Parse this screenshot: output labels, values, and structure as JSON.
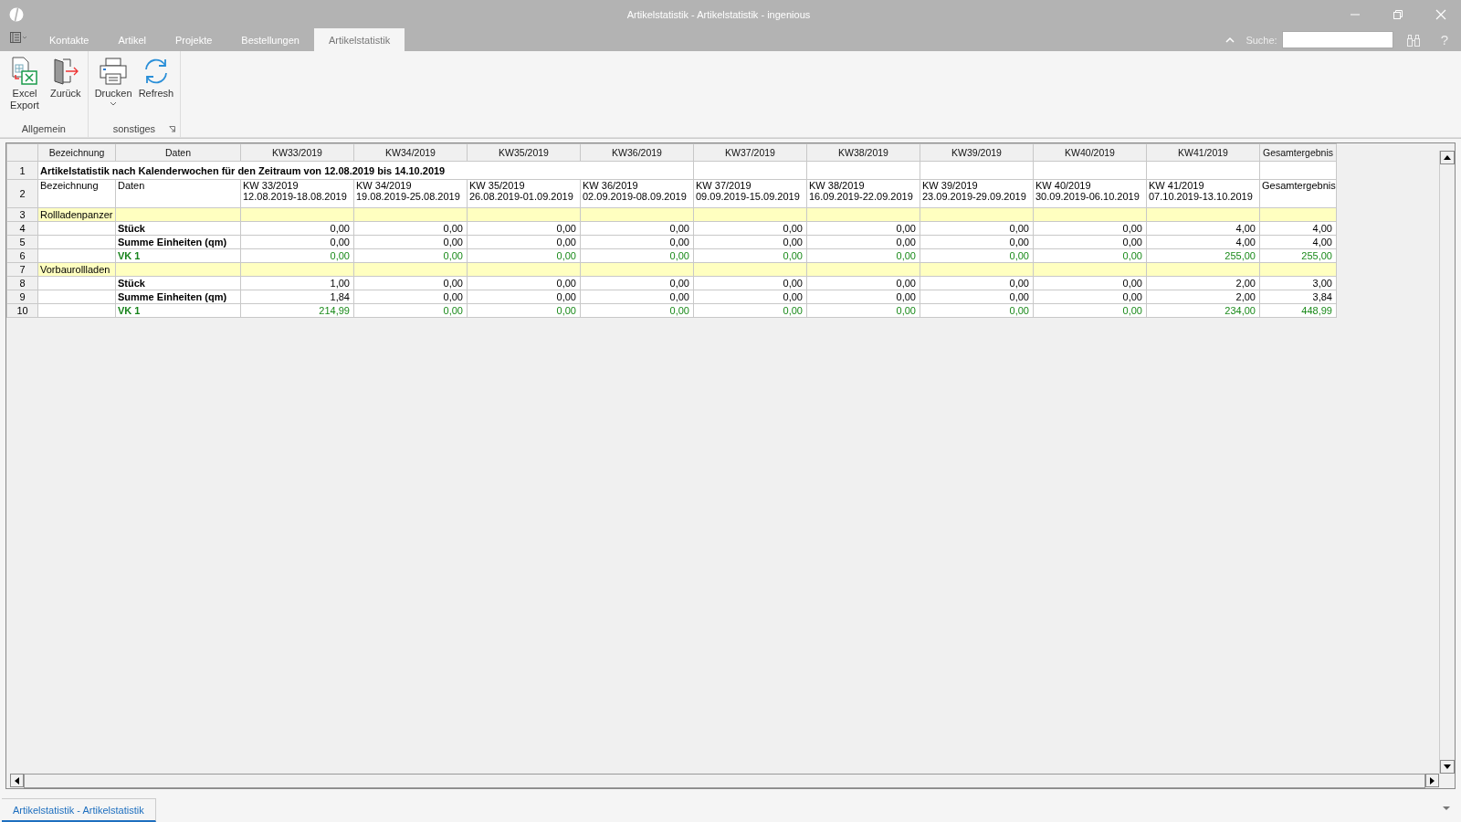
{
  "window": {
    "title": "Artikelstatistik - Artikelstatistik - ingenious"
  },
  "menu_tabs": [
    {
      "label": "Kontakte",
      "selected": false
    },
    {
      "label": "Artikel",
      "selected": false
    },
    {
      "label": "Projekte",
      "selected": false
    },
    {
      "label": "Bestellungen",
      "selected": false
    },
    {
      "label": "Artikelstatistik",
      "selected": true
    }
  ],
  "search": {
    "label": "Suche:"
  },
  "help_button": "?",
  "ribbon": {
    "groups": [
      {
        "label": "Allgemein",
        "launcher": false,
        "buttons": [
          {
            "label": "Excel Export",
            "kind": "excel",
            "dropdown": false
          },
          {
            "label": "Zurück",
            "kind": "back",
            "dropdown": false
          }
        ]
      },
      {
        "label": "sonstiges",
        "launcher": true,
        "buttons": [
          {
            "label": "Drucken",
            "kind": "print",
            "dropdown": true
          },
          {
            "label": "Refresh",
            "kind": "refresh",
            "dropdown": false
          }
        ]
      }
    ]
  },
  "grid": {
    "columns": [
      "Bezeichnung",
      "Daten",
      "KW33/2019",
      "KW34/2019",
      "KW35/2019",
      "KW36/2019",
      "KW37/2019",
      "KW38/2019",
      "KW39/2019",
      "KW40/2019",
      "KW41/2019",
      "Gesamtergebnis"
    ],
    "rows": [
      {
        "number": "1",
        "kind": "title",
        "text": "Artikelstatistik nach Kalenderwochen für den Zeitraum von  12.08.2019 bis 14.10.2019"
      },
      {
        "number": "2",
        "kind": "subheader",
        "cells": [
          [
            "Bezeichnung"
          ],
          [
            "Daten"
          ],
          [
            "KW 33/2019",
            "12.08.2019-18.08.2019"
          ],
          [
            "KW 34/2019",
            "19.08.2019-25.08.2019"
          ],
          [
            "KW 35/2019",
            "26.08.2019-01.09.2019"
          ],
          [
            "KW 36/2019",
            "02.09.2019-08.09.2019"
          ],
          [
            "KW 37/2019",
            "09.09.2019-15.09.2019"
          ],
          [
            "KW 38/2019",
            "16.09.2019-22.09.2019"
          ],
          [
            "KW 39/2019",
            "23.09.2019-29.09.2019"
          ],
          [
            "KW 40/2019",
            "30.09.2019-06.10.2019"
          ],
          [
            "KW 41/2019",
            "07.10.2019-13.10.2019"
          ],
          [
            "Gesamtergebnis"
          ]
        ]
      },
      {
        "number": "3",
        "kind": "group",
        "name": "Rollladenpanzer"
      },
      {
        "number": "4",
        "kind": "value",
        "label": "Stück",
        "values": [
          "0,00",
          "0,00",
          "0,00",
          "0,00",
          "0,00",
          "0,00",
          "0,00",
          "0,00",
          "4,00",
          "4,00"
        ]
      },
      {
        "number": "5",
        "kind": "value",
        "label": "Summe Einheiten (qm)",
        "values": [
          "0,00",
          "0,00",
          "0,00",
          "0,00",
          "0,00",
          "0,00",
          "0,00",
          "0,00",
          "4,00",
          "4,00"
        ]
      },
      {
        "number": "6",
        "kind": "price",
        "label": "VK 1",
        "values": [
          "0,00",
          "0,00",
          "0,00",
          "0,00",
          "0,00",
          "0,00",
          "0,00",
          "0,00",
          "255,00",
          "255,00"
        ]
      },
      {
        "number": "7",
        "kind": "group",
        "name": "Vorbaurollladen"
      },
      {
        "number": "8",
        "kind": "value",
        "label": "Stück",
        "values": [
          "1,00",
          "0,00",
          "0,00",
          "0,00",
          "0,00",
          "0,00",
          "0,00",
          "0,00",
          "2,00",
          "3,00"
        ]
      },
      {
        "number": "9",
        "kind": "value",
        "label": "Summe Einheiten (qm)",
        "values": [
          "1,84",
          "0,00",
          "0,00",
          "0,00",
          "0,00",
          "0,00",
          "0,00",
          "0,00",
          "2,00",
          "3,84"
        ]
      },
      {
        "number": "10",
        "kind": "price",
        "label": "VK 1",
        "values": [
          "214,99",
          "0,00",
          "0,00",
          "0,00",
          "0,00",
          "0,00",
          "0,00",
          "0,00",
          "234,00",
          "448,99"
        ]
      }
    ]
  },
  "document_tabs": [
    {
      "label": "Artikelstatistik - Artikelstatistik",
      "selected": true
    }
  ]
}
